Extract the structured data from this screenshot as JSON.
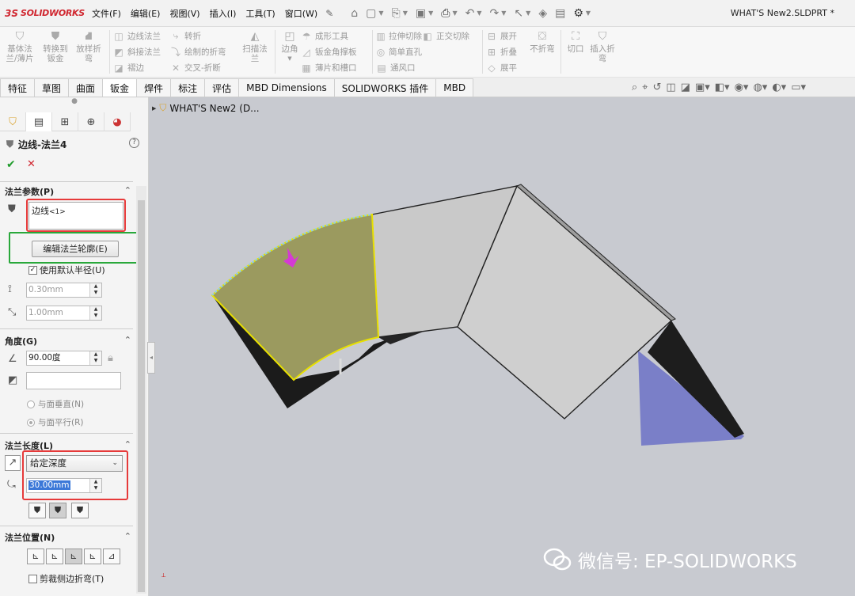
{
  "app": {
    "logo_ds": "3S",
    "logo_name": "SOLIDWORKS",
    "doc_title": "WHAT'S New2.SLDPRT *"
  },
  "menu": [
    "文件(F)",
    "编辑(E)",
    "视图(V)",
    "插入(I)",
    "工具(T)",
    "窗口(W)"
  ],
  "command_manager": {
    "big_buttons": [
      {
        "label1": "基体法",
        "label2": "兰/薄片"
      },
      {
        "label1": "转换到",
        "label2": "钣金"
      },
      {
        "label1": "放样折",
        "label2": "弯"
      }
    ],
    "col1": [
      "边线法兰",
      "斜接法兰",
      "褶边"
    ],
    "col2": [
      "转折",
      "绘制的折弯",
      "交叉-折断"
    ],
    "scan": {
      "label1": "扫描法",
      "label2": "兰"
    },
    "corner": "边角",
    "col3": [
      "成形工具",
      "钣金角撑板",
      "薄片和槽口"
    ],
    "col4": [
      "拉伸切除",
      "简单直孔",
      "通风口"
    ],
    "normal_cut": "正交切除",
    "col5": [
      "展开",
      "折叠",
      "展平"
    ],
    "no_bend": "不折弯",
    "cutout": "切口",
    "insert_bend": {
      "label1": "插入折",
      "label2": "弯"
    }
  },
  "tabs": [
    "特征",
    "草图",
    "曲面",
    "钣金",
    "焊件",
    "标注",
    "评估",
    "MBD Dimensions",
    "SOLIDWORKS 插件",
    "MBD"
  ],
  "active_tab": "钣金",
  "property_manager": {
    "feature_name": "边线-法兰4",
    "help": "?",
    "sections": {
      "flange_params": "法兰参数(P)",
      "angle": "角度(G)",
      "flange_length": "法兰长度(L)",
      "flange_position": "法兰位置(N)"
    },
    "edge_selection": "边线",
    "edge_selection_suffix": "<1>",
    "edit_profile_button": "编辑法兰轮廓(E)",
    "use_default_radius": "使用默认半径(U)",
    "use_default_radius_checked": true,
    "radius_value": "0.30mm",
    "gap_value": "1.00mm",
    "angle_value": "90.00度",
    "perpendicular_label": "与面垂直(N)",
    "parallel_label": "与面平行(R)",
    "end_condition": "给定深度",
    "length_value": "30.00mm",
    "trim_label": "剪裁侧边折弯(T)"
  },
  "graphics": {
    "tree_title": "WHAT'S New2  (D..."
  },
  "watermark": "微信号: EP-SOLIDWORKS",
  "colors": {
    "brand_red": "#d0262f",
    "highlight_red": "#e63a3a",
    "highlight_green": "#29a83b",
    "selected_face": "#9b9a5f",
    "viewport_bg": "#c8cad0"
  }
}
